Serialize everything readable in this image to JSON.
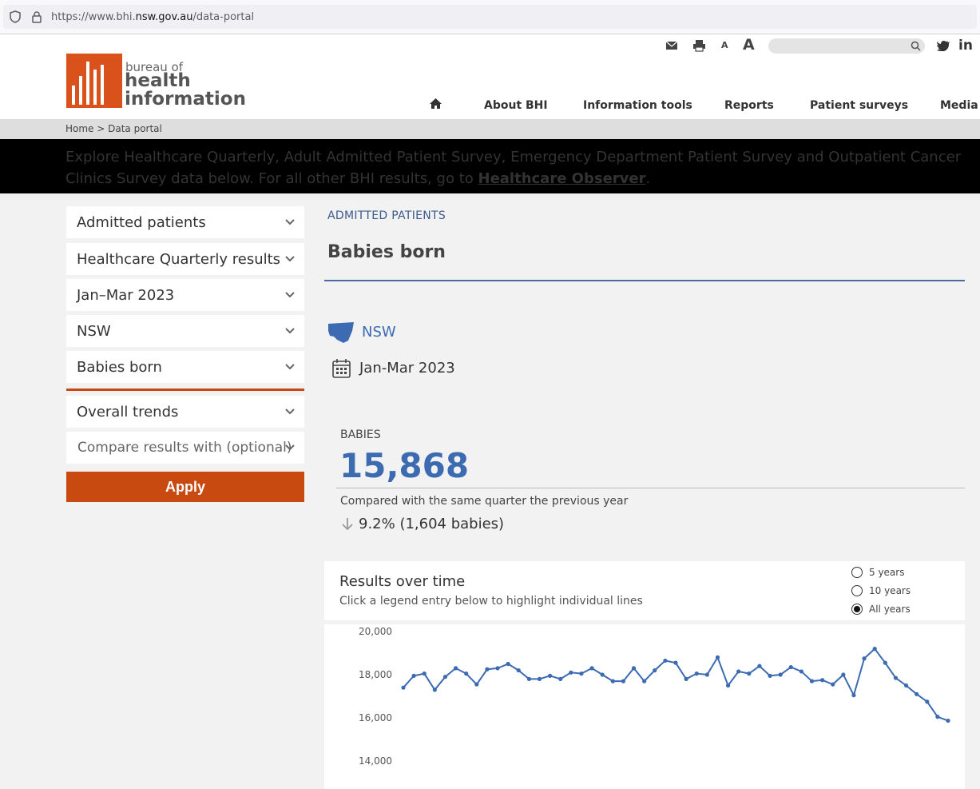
{
  "browser": {
    "url_prefix": "https://www.bhi.",
    "url_domain": "nsw.gov.au",
    "url_path": "/data-portal"
  },
  "brand": {
    "line1": "bureau of",
    "line2": "health",
    "line3": "information",
    "color": "#d9521b"
  },
  "nav": {
    "items": [
      "About BHI",
      "Information tools",
      "Reports",
      "Patient surveys",
      "Media"
    ]
  },
  "breadcrumb": "Home > Data portal",
  "banner": {
    "text": "Explore Healthcare Quarterly, Adult Admitted Patient Survey, Emergency Department Patient Survey and Outpatient Cancer Clinics Survey data below. For all other BHI results, go to ",
    "link": "Healthcare Observer",
    "end": "."
  },
  "sidebar": {
    "dropdowns": [
      "Admitted patients",
      "Healthcare Quarterly results",
      "Jan–Mar 2023",
      "NSW",
      "Babies born"
    ],
    "trend": "Overall trends",
    "compare": "Compare results with (optional)",
    "apply": "Apply"
  },
  "main": {
    "eyebrow": "ADMITTED PATIENTS",
    "title": "Babies born",
    "region": "NSW",
    "period": "Jan-Mar 2023",
    "stat": {
      "label": "BABIES",
      "value": "15,868",
      "compare_text": "Compared with the same quarter the previous year",
      "change": "9.2% (1,604 babies)"
    }
  },
  "chart": {
    "title": "Results over time",
    "subtitle": "Click a legend entry below to highlight individual lines",
    "ranges": [
      {
        "label": "5 years",
        "selected": false
      },
      {
        "label": "10 years",
        "selected": false
      },
      {
        "label": "All years",
        "selected": true
      }
    ]
  },
  "chart_data": {
    "type": "line",
    "y_ticks": [
      "20,000",
      "18,000",
      "16,000",
      "14,000"
    ],
    "ylim": [
      14000,
      20000
    ],
    "line_color": "#3c6bb2",
    "series": [
      {
        "values": [
          17400,
          17950,
          18050,
          17300,
          17900,
          18300,
          18050,
          17550,
          18250,
          18300,
          18500,
          18200,
          17800,
          17800,
          17950,
          17800,
          18100,
          18050,
          18300,
          18000,
          17700,
          17700,
          18300,
          17700,
          18200,
          18650,
          18550,
          17800,
          18050,
          18000,
          18800,
          17500,
          18150,
          18050,
          18400,
          17950,
          18000,
          18350,
          18150,
          17700,
          17750,
          17550,
          18000,
          17050,
          18750,
          19200,
          18550,
          17850,
          17500,
          17100,
          16750,
          16050,
          15868
        ]
      }
    ]
  }
}
